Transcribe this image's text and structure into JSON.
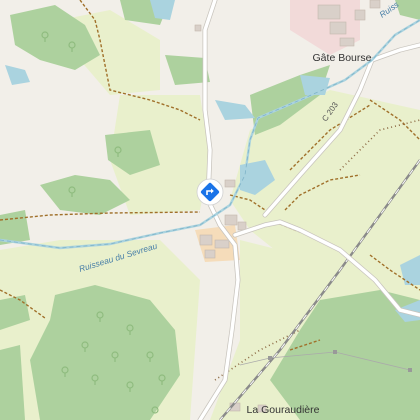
{
  "map": {
    "places": {
      "hamlet_north": "Gâte Bourse",
      "hamlet_south": "La Gouraudière"
    },
    "waterways": {
      "stream": "Ruisseau du Sevreau",
      "stream_ne": "Ruiss"
    },
    "roads": {
      "road_ref": "C 203"
    },
    "marker": {
      "icon": "directions-diamond-icon",
      "color": "#1a73e8"
    },
    "colors": {
      "background": "#f2efe9",
      "forest": "#add19e",
      "meadow": "#e8f0c8",
      "water": "#aad3df",
      "building": "#d9d0c9",
      "farmyard": "#f5dcba",
      "residential": "#f2dad9",
      "road": "#ffffff",
      "track": "#a0702a",
      "boundary": "#7a5c3a"
    }
  }
}
